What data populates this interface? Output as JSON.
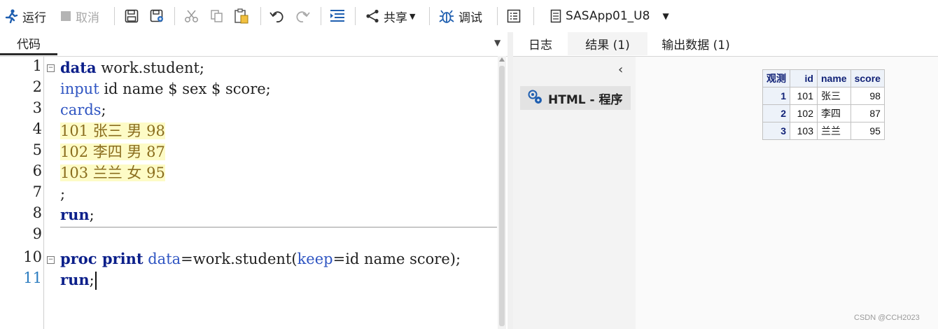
{
  "toolbar": {
    "run_label": "运行",
    "cancel_label": "取消",
    "share_label": "共享",
    "debug_label": "调试",
    "server_label": "SASApp01_U8"
  },
  "editor": {
    "tab_label": "代码",
    "line_numbers": [
      "1",
      "2",
      "3",
      "4",
      "5",
      "6",
      "7",
      "8",
      "9",
      "10",
      "11"
    ],
    "lines": [
      {
        "keyword": "data",
        "rest": " work.student;"
      },
      {
        "kw_blue": "input",
        "rest": " id name $ sex $ score;"
      },
      {
        "kw_blue": "cards",
        "rest": ";"
      },
      {
        "data": "101 张三 男 98"
      },
      {
        "data": "102 李四 男 87"
      },
      {
        "data": "103 兰兰 女 95"
      },
      {
        "text": ";"
      },
      {
        "keyword": "run",
        "rest": ";"
      },
      {
        "text": ""
      },
      {
        "keyword": "proc print",
        "opt1": "data",
        "mid": "=work.student(",
        "opt2": "keep",
        "rest": "=id name score);"
      },
      {
        "keyword": "run",
        "rest": ";"
      }
    ]
  },
  "right_panel": {
    "tabs": [
      "日志",
      "结果 (1)",
      "输出数据 (1)"
    ],
    "nav_item_label": "HTML - 程序"
  },
  "results_table": {
    "headers": [
      "观测",
      "id",
      "name",
      "score"
    ],
    "rows": [
      [
        "1",
        "101",
        "张三",
        "98"
      ],
      [
        "2",
        "102",
        "李四",
        "87"
      ],
      [
        "3",
        "103",
        "兰兰",
        "95"
      ]
    ]
  },
  "watermark": "CSDN @CCH2023",
  "colors": {
    "keyword": "#0b1f8a",
    "option": "#2f55c2",
    "datalines_bg": "#fdfbc6",
    "datalines_fg": "#8a6d1e"
  }
}
